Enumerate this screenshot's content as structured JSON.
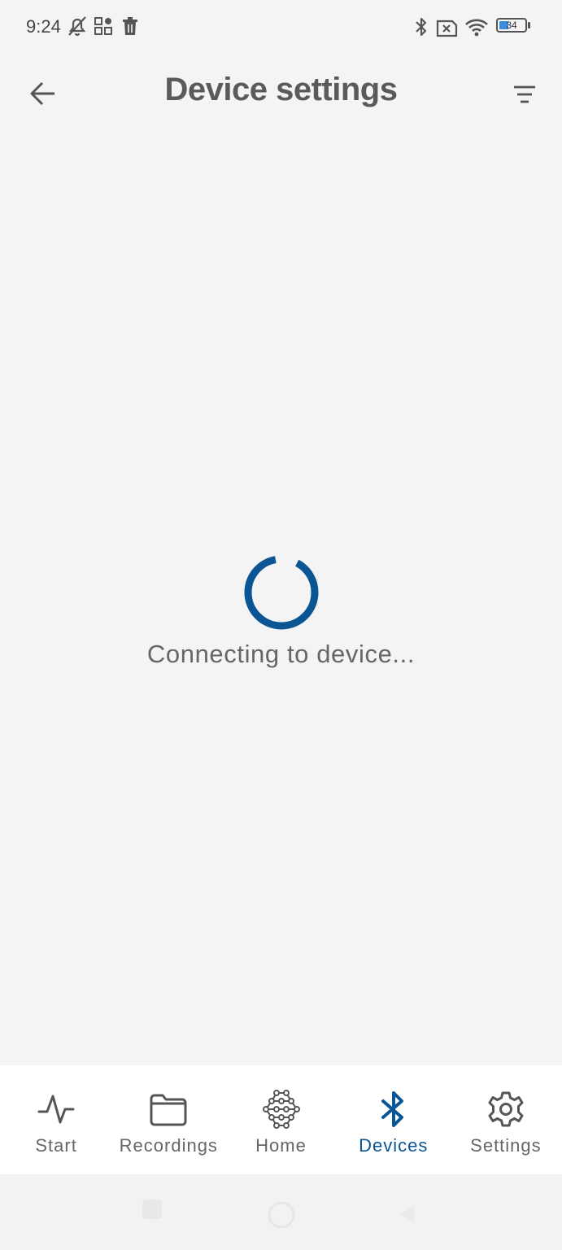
{
  "status_bar": {
    "time": "9:24",
    "battery": "34",
    "icons": [
      "bell-off-icon",
      "apps-icon",
      "trash-icon",
      "bluetooth-icon",
      "sim-off-icon",
      "wifi-icon",
      "battery-icon"
    ]
  },
  "header": {
    "title": "Device settings",
    "back_icon": "arrow-left-icon",
    "filter_icon": "filter-icon"
  },
  "loading": {
    "message": "Connecting to device..."
  },
  "bottom_nav": {
    "items": [
      {
        "label": "Start",
        "icon": "pulse-icon",
        "active": false
      },
      {
        "label": "Recordings",
        "icon": "folder-icon",
        "active": false
      },
      {
        "label": "Home",
        "icon": "network-icon",
        "active": false
      },
      {
        "label": "Devices",
        "icon": "bluetooth-icon",
        "active": true
      },
      {
        "label": "Settings",
        "icon": "gear-icon",
        "active": false
      }
    ]
  },
  "colors": {
    "accent": "#0a5695",
    "background": "#f4f4f4",
    "nav_background": "#ffffff"
  }
}
